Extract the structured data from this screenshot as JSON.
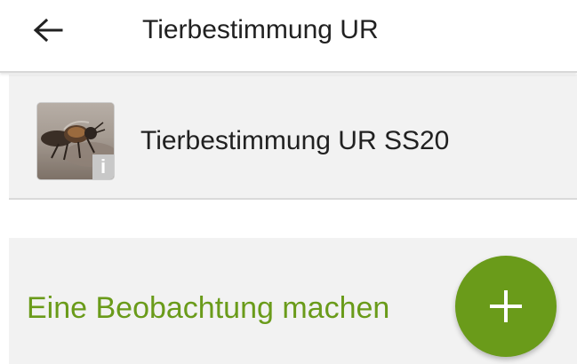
{
  "appbar": {
    "back_icon": "arrow-left-icon",
    "title": "Tierbestimmung UR"
  },
  "project": {
    "name": "Tierbestimmung UR SS20",
    "thumbnail": "bee-photo",
    "info_badge": "i"
  },
  "observation": {
    "label": "Eine Beobachtung machen",
    "add_icon": "plus-icon"
  },
  "colors": {
    "accent": "#6a9b1a",
    "card_background": "#f2f2f2",
    "text_primary": "#212121"
  }
}
